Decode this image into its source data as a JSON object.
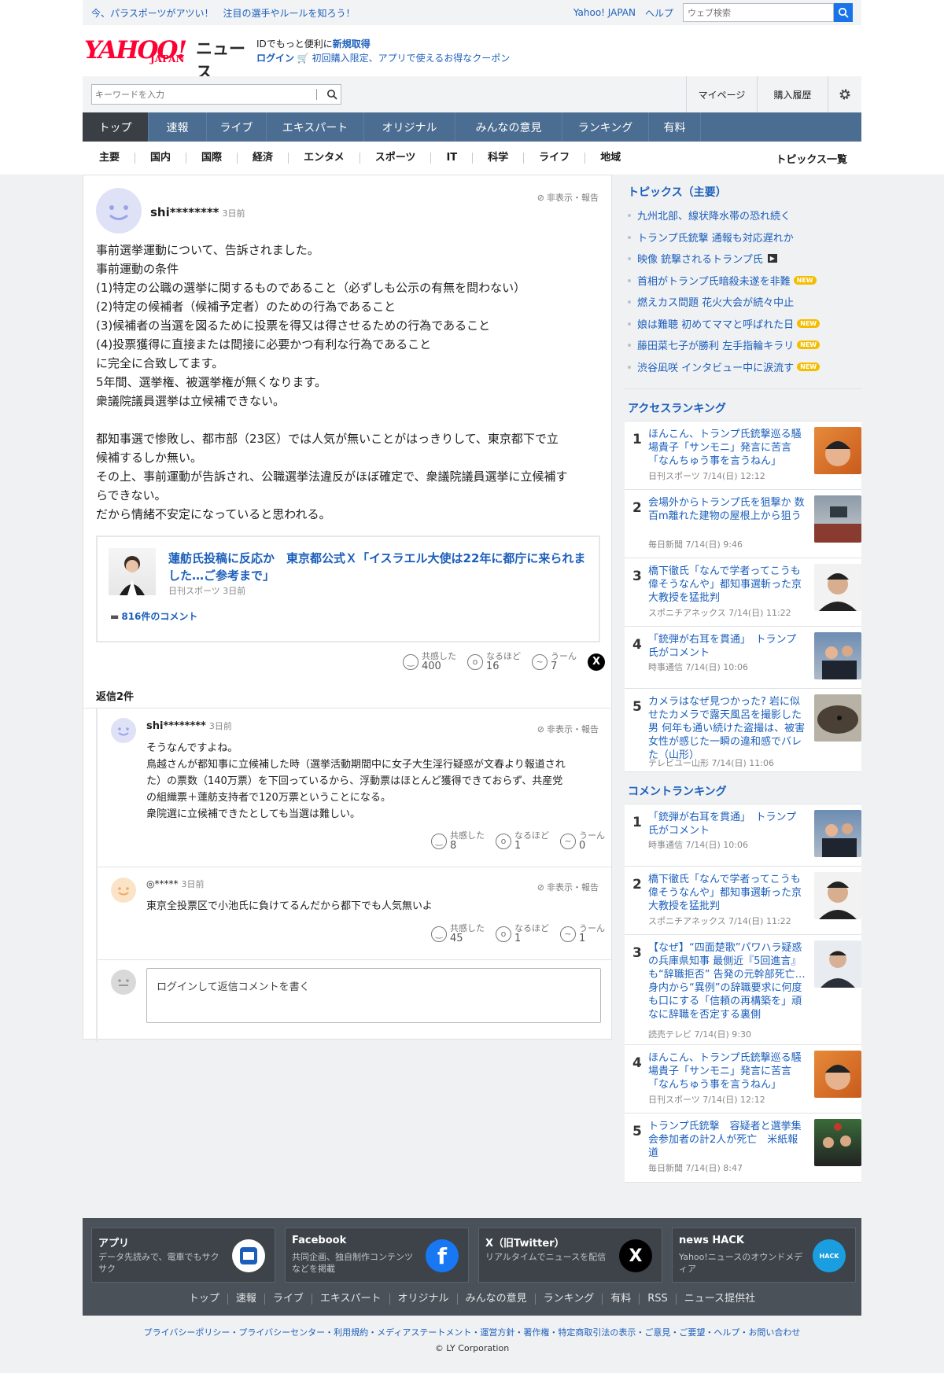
{
  "topbar": {
    "promo": "今、パラスポーツがアツい！　注目の選手やルールを知ろう！",
    "yahoo_japan": "Yahoo! JAPAN",
    "help": "ヘルプ",
    "web_search_placeholder": "ウェブ検索"
  },
  "logo": {
    "text": "YAHOO!",
    "japan": "JAPAN",
    "news": "ニュース"
  },
  "idbox": {
    "line1_prefix": "IDでもっと便利に",
    "line1_link": "新規取得",
    "login": "ログイン",
    "coupon": "初回購入限定、アプリで使えるお得なクーポン"
  },
  "search": {
    "placeholder": "キーワードを入力"
  },
  "user_menu": {
    "mypage": "マイページ",
    "history": "購入履歴"
  },
  "global_nav": [
    "トップ",
    "速報",
    "ライブ",
    "エキスパート",
    "オリジナル",
    "みんなの意見",
    "ランキング",
    "有料"
  ],
  "sub_nav": [
    "主要",
    "国内",
    "国際",
    "経済",
    "エンタメ",
    "スポーツ",
    "IT",
    "科学",
    "ライフ",
    "地域"
  ],
  "topics_all": "トピックス一覧",
  "comment": {
    "user": "shi********",
    "time": "3日前",
    "hide_report": "非表示・報告",
    "lines": [
      "事前選挙運動について、告訴されました。",
      "事前運動の条件",
      "(1)特定の公職の選挙に関するものであること（必ずしも公示の有無を問わない）",
      "(2)特定の候補者（候補予定者）のための行為であること",
      "(3)候補者の当選を図るために投票を得又は得させるための行為であること",
      "(4)投票獲得に直接または間接に必要かつ有利な行為であること",
      "に完全に合致してます。",
      "5年間、選挙権、被選挙権が無くなります。",
      "衆議院議員選挙は立候補できない。",
      "",
      "都知事選で惨敗し、都市部（23区）では人気が無いことがはっきりして、東京都下で立",
      "候補するしか無い。",
      "その上、事前運動が告訴され、公職選挙法違反がほぼ確定で、衆議院議員選挙に立候補す",
      "らできない。",
      "だから情緒不安定になっていると思われる。"
    ],
    "article": {
      "title": "蓮舫氏投稿に反応か　東京都公式Ｘ「イスラエル大使は22年に都庁に来られました…ご参考まで」",
      "source": "日刊スポーツ 3日前",
      "comments": "816件のコメント"
    },
    "reactions": [
      {
        "label": "共感した",
        "count": "400"
      },
      {
        "label": "なるほど",
        "count": "16"
      },
      {
        "label": "うーん",
        "count": "7"
      }
    ]
  },
  "replies_label": "返信2件",
  "replies": [
    {
      "user": "shi********",
      "time": "3日前",
      "hide_report": "非表示・報告",
      "lines": [
        "そうなんですよね。",
        "鳥越さんが都知事に立候補した時（選挙活動期間中に女子大生淫行疑惑が文春より報道され",
        "た）の票数（140万票）を下回っているから、浮動票はほとんど獲得できておらず、共産党",
        "の組織票＋蓮舫支持者で120万票ということになる。",
        "衆院選に立候補できたとしても当選は難しい。"
      ],
      "reactions": [
        {
          "label": "共感した",
          "count": "8"
        },
        {
          "label": "なるほど",
          "count": "1"
        },
        {
          "label": "うーん",
          "count": "0"
        }
      ]
    },
    {
      "user": "◎*****",
      "time": "3日前",
      "hide_report": "非表示・報告",
      "lines": [
        "東京全投票区で小池氏に負けてるんだから都下でも人気無いよ"
      ],
      "reactions": [
        {
          "label": "共感した",
          "count": "45"
        },
        {
          "label": "なるほど",
          "count": "1"
        },
        {
          "label": "うーん",
          "count": "1"
        }
      ]
    }
  ],
  "reply_box": {
    "placeholder": "ログインして返信コメントを書く"
  },
  "topics": {
    "heading": "トピックス（主要）",
    "items": [
      {
        "text": "九州北部、線状降水帯の恐れ続く",
        "badge": ""
      },
      {
        "text": "トランプ氏銃撃 通報も対応遅れか",
        "badge": ""
      },
      {
        "text": "映像 銃撃されるトランプ氏",
        "badge": "video"
      },
      {
        "text": "首相がトランプ氏暗殺未遂を非難",
        "badge": "NEW"
      },
      {
        "text": "燃えカス問題 花火大会が続々中止",
        "badge": ""
      },
      {
        "text": "娘は難聴 初めてママと呼ばれた日",
        "badge": "NEW"
      },
      {
        "text": "藤田菜七子が勝利 左手指輪キラリ",
        "badge": "NEW"
      },
      {
        "text": "渋谷凪咲 インタビュー中に涙流す",
        "badge": "NEW"
      }
    ]
  },
  "access_ranking": {
    "heading": "アクセスランキング",
    "items": [
      {
        "rank": "1",
        "title": "ほんこん、トランプ氏銃撃巡る騒場貴子「サンモニ」発言に苦言「なんちゅう事を言うねん」",
        "source": "日刊スポーツ 7/14(日) 12:12"
      },
      {
        "rank": "2",
        "title": "会場外からトランプ氏を狙撃か 数百m離れた建物の屋根上から狙う",
        "source": "毎日新聞 7/14(日) 9:46"
      },
      {
        "rank": "3",
        "title": "橋下徹氏「なんで学者ってこうも偉そうなんや」都知事選斬った京大教授を猛批判",
        "source": "スポニチアネックス 7/14(日) 11:22"
      },
      {
        "rank": "4",
        "title": "「銃弾が右耳を貫通」　トランプ氏がコメント",
        "source": "時事通信 7/14(日) 10:06"
      },
      {
        "rank": "5",
        "title": "カメラはなぜ見つかった? 岩に似せたカメラで露天風呂を撮影した男 何年も通い続けた盗撮は、被害女性が感じた一瞬の違和感でバレた（山形）",
        "source": "テレビユー山形 7/14(日) 11:06"
      }
    ]
  },
  "comment_ranking": {
    "heading": "コメントランキング",
    "items": [
      {
        "rank": "1",
        "title": "「銃弾が右耳を貫通」　トランプ氏がコメント",
        "source": "時事通信 7/14(日) 10:06"
      },
      {
        "rank": "2",
        "title": "橋下徹氏「なんで学者ってこうも偉そうなんや」都知事選斬った京大教授を猛批判",
        "source": "スポニチアネックス 7/14(日) 11:22"
      },
      {
        "rank": "3",
        "title": "【なぜ】“四面楚歌”パワハラ疑惑の兵庫県知事 最側近『5回進言』も“辞職拒否” 告発の元幹部死亡…身内から“異例”の辞職要求に何度も口にする「信頼の再構築を」頑なに辞職を否定する裏側",
        "source": "読売テレビ 7/14(日) 9:30"
      },
      {
        "rank": "4",
        "title": "ほんこん、トランプ氏銃撃巡る騒場貴子「サンモニ」発言に苦言「なんちゅう事を言うねん」",
        "source": "日刊スポーツ 7/14(日) 12:12"
      },
      {
        "rank": "5",
        "title": "トランプ氏銃撃　容疑者と選挙集会参加者の計2人が死亡　米紙報道",
        "source": "毎日新聞 7/14(日) 8:47"
      }
    ]
  },
  "footer": {
    "cards": [
      {
        "title": "アプリ",
        "desc": "データ先読みで、電車でもサクサク"
      },
      {
        "title": "Facebook",
        "desc": "共同企画、独自制作コンテンツなどを掲載"
      },
      {
        "title": "X（旧Twitter）",
        "desc": "リアルタイムでニュースを配信"
      },
      {
        "title": "news HACK",
        "desc": "Yahoo!ニュースのオウンドメディア"
      }
    ],
    "links": [
      "トップ",
      "速報",
      "ライブ",
      "エキスパート",
      "オリジナル",
      "みんなの意見",
      "ランキング",
      "有料",
      "RSS",
      "ニュース提供社"
    ],
    "legal": "プライバシーポリシー・プライバシーセンター・利用規約・メディアステートメント・運営方針・著作権・特定商取引法の表示・ご意見・ご要望・ヘルプ・お問い合わせ",
    "copyright": "© LY Corporation"
  },
  "colors": {
    "accent": "#1c5fbb",
    "nav": "#4b6d91",
    "nav_active": "#3a3f45",
    "brand": "#ff0033",
    "new_badge": "#f5bd00"
  }
}
